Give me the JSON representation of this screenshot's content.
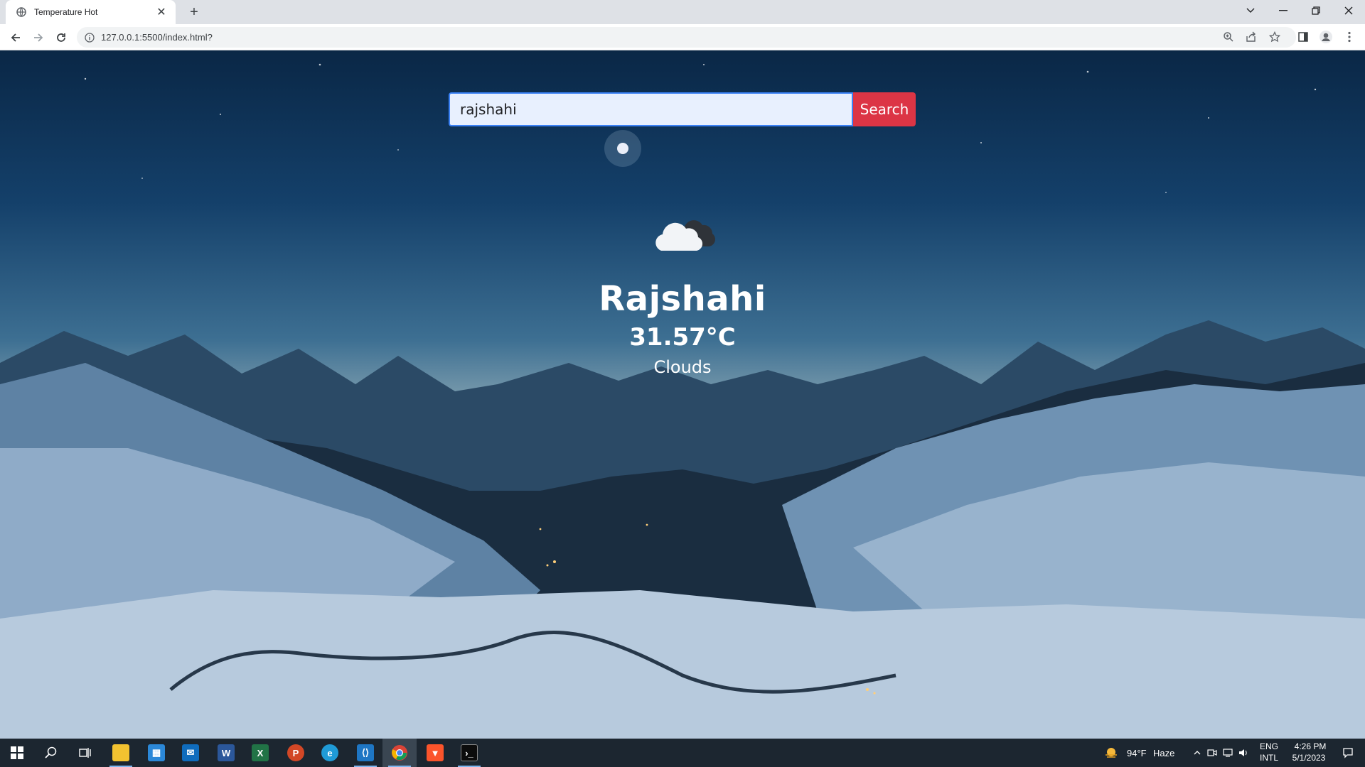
{
  "browser": {
    "tab_title": "Temperature Hot",
    "url": "127.0.0.1:5500/index.html?"
  },
  "search": {
    "value": "rajshahi",
    "button_label": "Search"
  },
  "weather": {
    "city": "Rajshahi",
    "temperature": "31.57°C",
    "condition": "Clouds",
    "icon": "cloud-icon"
  },
  "taskbar": {
    "apps": [
      "start-icon",
      "search-icon",
      "task-view-icon",
      "file-explorer-icon",
      "store-icon",
      "mail-icon",
      "word-icon",
      "excel-icon",
      "powerpoint-icon",
      "edge-icon",
      "vscode-icon",
      "chrome-icon",
      "brave-icon",
      "terminal-icon"
    ],
    "weather_temp": "94°F",
    "weather_desc": "Haze",
    "lang_top": "ENG",
    "lang_bottom": "INTL",
    "time": "4:26 PM",
    "date": "5/1/2023"
  },
  "colors": {
    "search_button": "#dc3545",
    "input_border": "#3b82f6",
    "taskbar": "#1c2630"
  }
}
